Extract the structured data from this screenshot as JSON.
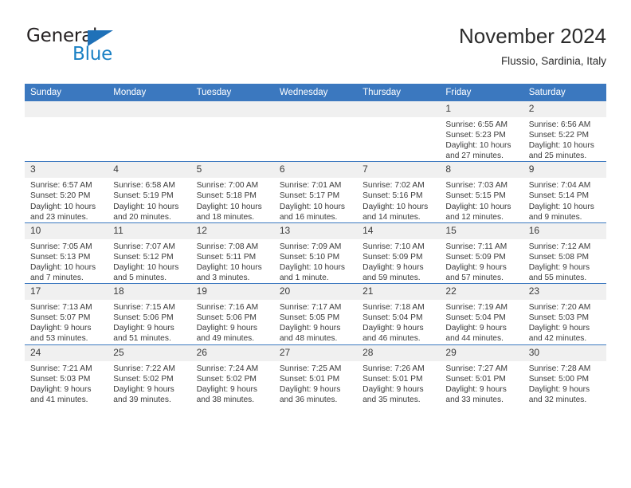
{
  "brand": {
    "name_part1": "General",
    "name_part2": "Blue",
    "triangle_icon": "triangle-logo-icon",
    "color_dark": "#231f20",
    "color_blue": "#1a80c4"
  },
  "header": {
    "month_title": "November 2024",
    "location": "Flussio, Sardinia, Italy"
  },
  "theme": {
    "header_blue": "#3b78bf",
    "daynum_band": "#f0f0f0",
    "text": "#3a3a3a"
  },
  "weekday_headers": [
    "Sunday",
    "Monday",
    "Tuesday",
    "Wednesday",
    "Thursday",
    "Friday",
    "Saturday"
  ],
  "weeks": [
    [
      {
        "day": "",
        "sunrise": "",
        "sunset": "",
        "daylight": "",
        "empty": true
      },
      {
        "day": "",
        "sunrise": "",
        "sunset": "",
        "daylight": "",
        "empty": true
      },
      {
        "day": "",
        "sunrise": "",
        "sunset": "",
        "daylight": "",
        "empty": true
      },
      {
        "day": "",
        "sunrise": "",
        "sunset": "",
        "daylight": "",
        "empty": true
      },
      {
        "day": "",
        "sunrise": "",
        "sunset": "",
        "daylight": "",
        "empty": true
      },
      {
        "day": "1",
        "sunrise": "Sunrise: 6:55 AM",
        "sunset": "Sunset: 5:23 PM",
        "daylight": "Daylight: 10 hours and 27 minutes.",
        "empty": false
      },
      {
        "day": "2",
        "sunrise": "Sunrise: 6:56 AM",
        "sunset": "Sunset: 5:22 PM",
        "daylight": "Daylight: 10 hours and 25 minutes.",
        "empty": false
      }
    ],
    [
      {
        "day": "3",
        "sunrise": "Sunrise: 6:57 AM",
        "sunset": "Sunset: 5:20 PM",
        "daylight": "Daylight: 10 hours and 23 minutes.",
        "empty": false
      },
      {
        "day": "4",
        "sunrise": "Sunrise: 6:58 AM",
        "sunset": "Sunset: 5:19 PM",
        "daylight": "Daylight: 10 hours and 20 minutes.",
        "empty": false
      },
      {
        "day": "5",
        "sunrise": "Sunrise: 7:00 AM",
        "sunset": "Sunset: 5:18 PM",
        "daylight": "Daylight: 10 hours and 18 minutes.",
        "empty": false
      },
      {
        "day": "6",
        "sunrise": "Sunrise: 7:01 AM",
        "sunset": "Sunset: 5:17 PM",
        "daylight": "Daylight: 10 hours and 16 minutes.",
        "empty": false
      },
      {
        "day": "7",
        "sunrise": "Sunrise: 7:02 AM",
        "sunset": "Sunset: 5:16 PM",
        "daylight": "Daylight: 10 hours and 14 minutes.",
        "empty": false
      },
      {
        "day": "8",
        "sunrise": "Sunrise: 7:03 AM",
        "sunset": "Sunset: 5:15 PM",
        "daylight": "Daylight: 10 hours and 12 minutes.",
        "empty": false
      },
      {
        "day": "9",
        "sunrise": "Sunrise: 7:04 AM",
        "sunset": "Sunset: 5:14 PM",
        "daylight": "Daylight: 10 hours and 9 minutes.",
        "empty": false
      }
    ],
    [
      {
        "day": "10",
        "sunrise": "Sunrise: 7:05 AM",
        "sunset": "Sunset: 5:13 PM",
        "daylight": "Daylight: 10 hours and 7 minutes.",
        "empty": false
      },
      {
        "day": "11",
        "sunrise": "Sunrise: 7:07 AM",
        "sunset": "Sunset: 5:12 PM",
        "daylight": "Daylight: 10 hours and 5 minutes.",
        "empty": false
      },
      {
        "day": "12",
        "sunrise": "Sunrise: 7:08 AM",
        "sunset": "Sunset: 5:11 PM",
        "daylight": "Daylight: 10 hours and 3 minutes.",
        "empty": false
      },
      {
        "day": "13",
        "sunrise": "Sunrise: 7:09 AM",
        "sunset": "Sunset: 5:10 PM",
        "daylight": "Daylight: 10 hours and 1 minute.",
        "empty": false
      },
      {
        "day": "14",
        "sunrise": "Sunrise: 7:10 AM",
        "sunset": "Sunset: 5:09 PM",
        "daylight": "Daylight: 9 hours and 59 minutes.",
        "empty": false
      },
      {
        "day": "15",
        "sunrise": "Sunrise: 7:11 AM",
        "sunset": "Sunset: 5:09 PM",
        "daylight": "Daylight: 9 hours and 57 minutes.",
        "empty": false
      },
      {
        "day": "16",
        "sunrise": "Sunrise: 7:12 AM",
        "sunset": "Sunset: 5:08 PM",
        "daylight": "Daylight: 9 hours and 55 minutes.",
        "empty": false
      }
    ],
    [
      {
        "day": "17",
        "sunrise": "Sunrise: 7:13 AM",
        "sunset": "Sunset: 5:07 PM",
        "daylight": "Daylight: 9 hours and 53 minutes.",
        "empty": false
      },
      {
        "day": "18",
        "sunrise": "Sunrise: 7:15 AM",
        "sunset": "Sunset: 5:06 PM",
        "daylight": "Daylight: 9 hours and 51 minutes.",
        "empty": false
      },
      {
        "day": "19",
        "sunrise": "Sunrise: 7:16 AM",
        "sunset": "Sunset: 5:06 PM",
        "daylight": "Daylight: 9 hours and 49 minutes.",
        "empty": false
      },
      {
        "day": "20",
        "sunrise": "Sunrise: 7:17 AM",
        "sunset": "Sunset: 5:05 PM",
        "daylight": "Daylight: 9 hours and 48 minutes.",
        "empty": false
      },
      {
        "day": "21",
        "sunrise": "Sunrise: 7:18 AM",
        "sunset": "Sunset: 5:04 PM",
        "daylight": "Daylight: 9 hours and 46 minutes.",
        "empty": false
      },
      {
        "day": "22",
        "sunrise": "Sunrise: 7:19 AM",
        "sunset": "Sunset: 5:04 PM",
        "daylight": "Daylight: 9 hours and 44 minutes.",
        "empty": false
      },
      {
        "day": "23",
        "sunrise": "Sunrise: 7:20 AM",
        "sunset": "Sunset: 5:03 PM",
        "daylight": "Daylight: 9 hours and 42 minutes.",
        "empty": false
      }
    ],
    [
      {
        "day": "24",
        "sunrise": "Sunrise: 7:21 AM",
        "sunset": "Sunset: 5:03 PM",
        "daylight": "Daylight: 9 hours and 41 minutes.",
        "empty": false
      },
      {
        "day": "25",
        "sunrise": "Sunrise: 7:22 AM",
        "sunset": "Sunset: 5:02 PM",
        "daylight": "Daylight: 9 hours and 39 minutes.",
        "empty": false
      },
      {
        "day": "26",
        "sunrise": "Sunrise: 7:24 AM",
        "sunset": "Sunset: 5:02 PM",
        "daylight": "Daylight: 9 hours and 38 minutes.",
        "empty": false
      },
      {
        "day": "27",
        "sunrise": "Sunrise: 7:25 AM",
        "sunset": "Sunset: 5:01 PM",
        "daylight": "Daylight: 9 hours and 36 minutes.",
        "empty": false
      },
      {
        "day": "28",
        "sunrise": "Sunrise: 7:26 AM",
        "sunset": "Sunset: 5:01 PM",
        "daylight": "Daylight: 9 hours and 35 minutes.",
        "empty": false
      },
      {
        "day": "29",
        "sunrise": "Sunrise: 7:27 AM",
        "sunset": "Sunset: 5:01 PM",
        "daylight": "Daylight: 9 hours and 33 minutes.",
        "empty": false
      },
      {
        "day": "30",
        "sunrise": "Sunrise: 7:28 AM",
        "sunset": "Sunset: 5:00 PM",
        "daylight": "Daylight: 9 hours and 32 minutes.",
        "empty": false
      }
    ]
  ]
}
